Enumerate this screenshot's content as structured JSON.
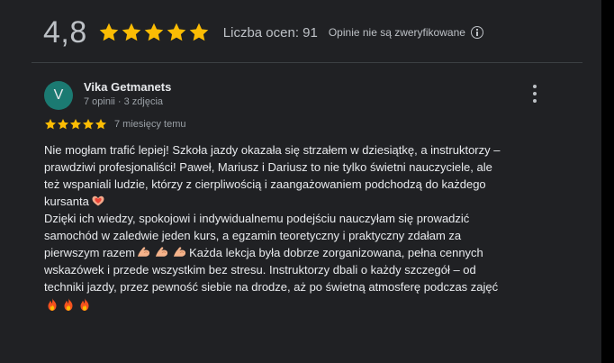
{
  "summary": {
    "rating_value": "4,8",
    "rating_stars": 5,
    "rating_count": "Liczba ocen: 91",
    "unverified_note": "Opinie nie są zweryfikowane"
  },
  "review": {
    "avatar_letter": "V",
    "author_name": "Vika Getmanets",
    "author_meta": "7 opinii · 3 zdjęcia",
    "stars": 5,
    "time": "7 miesięcy temu",
    "lines": [
      "Nie mogłam trafić lepiej! Szkoła jazdy okazała się strzałem w dziesiątkę, a instruktorzy –",
      "prawdziwi profesjonaliści! Paweł, Mariusz i Dariusz to nie tylko świetni nauczyciele, ale",
      "też wspaniali ludzie, którzy z cierpliwością i zaangażowaniem podchodzą do każdego",
      "kursanta",
      "Dzięki ich wiedzy, spokojowi i indywidualnemu podejściu nauczyłam się prowadzić",
      "samochód w zaledwie jeden kurs, a egzamin teoretyczny i praktyczny zdałam za",
      "pierwszym razem",
      "Każda lekcja była dobrze zorganizowana, pełna cennych",
      "wskazówek i przede wszystkim bez stresu. Instruktorzy dbali o każdy szczegół – od",
      "techniki jazdy, przez pewność siebie na drodze, aż po świetną atmosferę podczas zajęć"
    ]
  },
  "colors": {
    "star": "#fbbc04",
    "avatar": "#1b7a72",
    "background": "#202124"
  },
  "icons": [
    "star-icon",
    "info-icon",
    "more-vertical-icon",
    "heart-hands-emoji",
    "flexed-biceps-emoji",
    "fire-emoji"
  ]
}
